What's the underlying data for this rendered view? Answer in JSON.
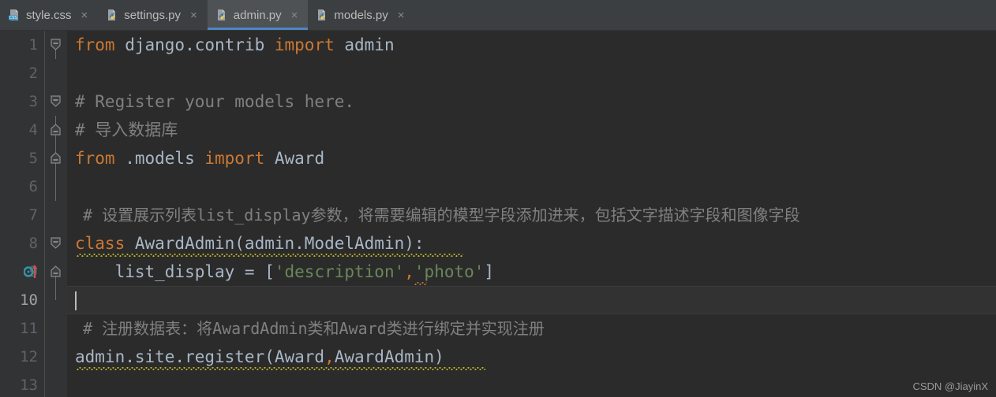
{
  "tabs": [
    {
      "label": "style.css",
      "icon": "css-file-icon",
      "active": false,
      "close": "×"
    },
    {
      "label": "settings.py",
      "icon": "python-file-icon",
      "active": false,
      "close": "×"
    },
    {
      "label": "admin.py",
      "icon": "python-file-icon",
      "active": true,
      "close": "×"
    },
    {
      "label": "models.py",
      "icon": "python-file-icon",
      "active": false,
      "close": "×"
    }
  ],
  "editor": {
    "active_file": "admin.py",
    "current_line": 10,
    "line_numbers": [
      "1",
      "2",
      "3",
      "4",
      "5",
      "6",
      "7",
      "8",
      "9",
      "10",
      "11",
      "12",
      "13"
    ],
    "lines": [
      {
        "n": 1,
        "text": "from django.contrib import admin"
      },
      {
        "n": 2,
        "text": ""
      },
      {
        "n": 3,
        "text": "# Register your models here."
      },
      {
        "n": 4,
        "text": "# 导入数据库"
      },
      {
        "n": 5,
        "text": "from .models import Award"
      },
      {
        "n": 6,
        "text": ""
      },
      {
        "n": 7,
        "text": "# 设置展示列表list_display参数，将需要编辑的模型字段添加进来，包括文字描述字段和图像字段"
      },
      {
        "n": 8,
        "text": "class AwardAdmin(admin.ModelAdmin):"
      },
      {
        "n": 9,
        "text": "    list_display = ['description','photo']"
      },
      {
        "n": 10,
        "text": ""
      },
      {
        "n": 11,
        "text": "# 注册数据表：将AwardAdmin类和Award类进行绑定并实现注册"
      },
      {
        "n": 12,
        "text": "admin.site.register(Award,AwardAdmin)"
      },
      {
        "n": 13,
        "text": ""
      }
    ],
    "tokens": {
      "l1_kw_from": "from",
      "l1_mod": " django.contrib ",
      "l1_kw_import": "import",
      "l1_name": " admin",
      "l3_comment": "# Register your models here.",
      "l4_comment": "# 导入数据库",
      "l5_kw_from": "from",
      "l5_mod": " .models ",
      "l5_kw_import": "import",
      "l5_name": " Award",
      "l7_comment": "# 设置展示列表list_display参数，将需要编辑的模型字段添加进来，包括文字描述字段和图像字段",
      "l8_kw_class": "class",
      "l8_rest": " AwardAdmin(admin.ModelAdmin):",
      "l9_indent_name": "    list_display = [",
      "l9_str1": "'description'",
      "l9_comma": ",",
      "l9_str2": "'photo'",
      "l9_close": "]",
      "l11_comment": "# 注册数据表：将AwardAdmin类和Award类进行绑定并实现注册",
      "l12_call": "admin.site.register(Award",
      "l12_comma": ",",
      "l12_tail": "AwardAdmin)"
    },
    "gutter_marker": {
      "name": "override-method-marker",
      "line": 9
    }
  },
  "watermark": "CSDN @JiayinX",
  "colors": {
    "editor_bg": "#2b2b2b",
    "gutter_bg": "#313335",
    "tabbar_bg": "#3c3f41",
    "active_tab_bg": "#4e5254",
    "accent": "#4a88c7",
    "keyword": "#cc7832",
    "string": "#6a8759",
    "comment": "#808080",
    "identifier": "#a9b7c6",
    "warning_squiggle": "#bbb529",
    "error_squiggle": "#c87430"
  }
}
